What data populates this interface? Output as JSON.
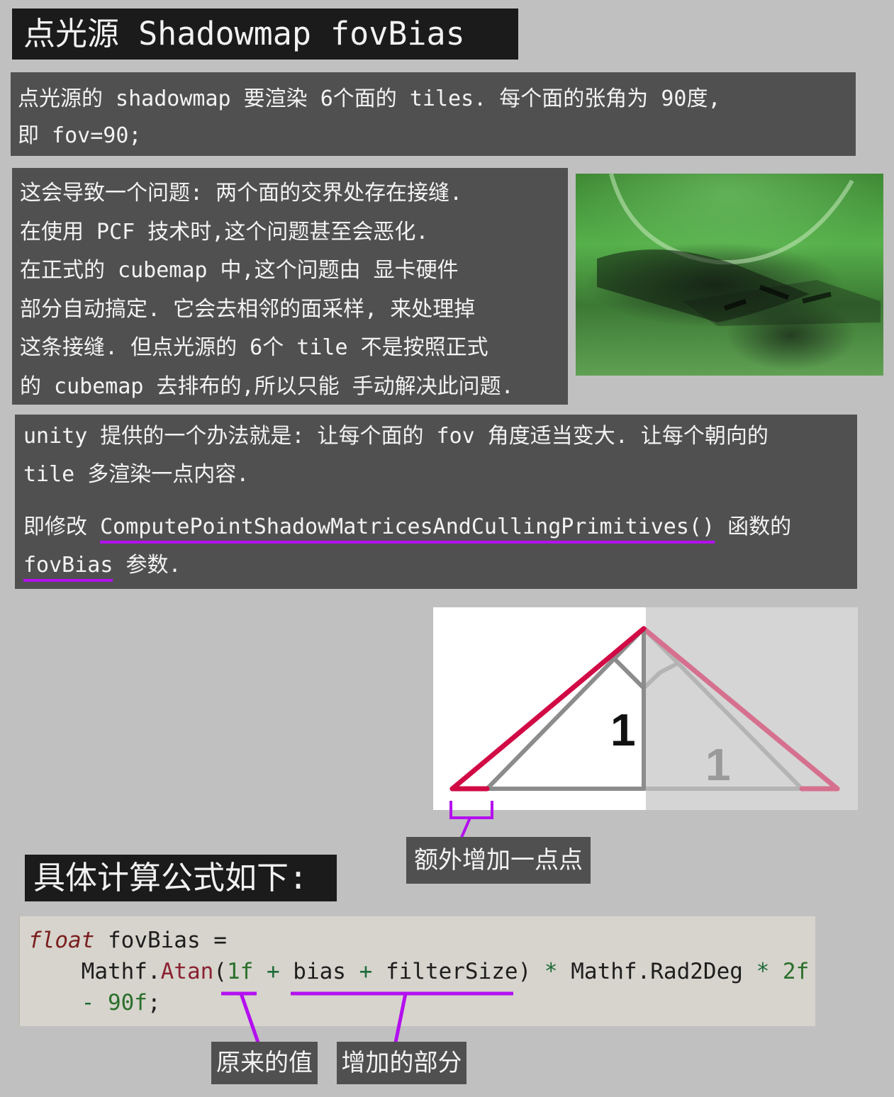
{
  "title": "点光源 Shadowmap fovBias",
  "intro": {
    "line1": "点光源的 shadowmap 要渲染 6个面的 tiles. 每个面的张角为 90度,",
    "line2": "即 fov=90;"
  },
  "problem": {
    "lines": [
      "这会导致一个问题: 两个面的交界处存在接缝.",
      "在使用 PCF 技术时,这个问题甚至会恶化.",
      "在正式的 cubemap 中,这个问题由 显卡硬件",
      "部分自动搞定. 它会去相邻的面采样, 来处理掉",
      "这条接缝. 但点光源的 6个 tile 不是按照正式",
      "的 cubemap 去排布的,所以只能 手动解决此问题."
    ]
  },
  "solution": {
    "line1": "unity 提供的一个办法就是: 让每个面的 fov 角度适当变大. 让每个朝向的",
    "line2": "tile 多渲染一点内容.",
    "line3_prefix": "即修改 ",
    "func_name": "ComputePointShadowMatricesAndCullingPrimitives()",
    "line3_suffix": " 函数的",
    "param_name": "fovBias",
    "line4_suffix": " 参数."
  },
  "diagram": {
    "label_main": "1",
    "label_faded": "1",
    "colors": {
      "edge": "#d10a45",
      "edge_faded": "#d6708f",
      "gray": "#8c8c8c",
      "gray_faded": "#b4b4b4",
      "accent": "#b40ff0"
    },
    "callout": "额外增加一点点"
  },
  "formula_heading": "具体计算公式如下:",
  "code": {
    "kw": "float",
    "var": " fovBias =",
    "l2_indent": "    ",
    "l2_obj": "Mathf.",
    "l2_fn": "Atan",
    "l2_open": "(",
    "l2_num1": "1f",
    "l2_plus1": " + ",
    "l2_bias": "bias",
    "l2_plus2": " + ",
    "l2_filter": "filterSize)",
    "l2_mul1": " * ",
    "l2_rad": "Mathf.Rad2Deg",
    "l2_mul2": " * ",
    "l2_num2": "2f",
    "l3_indent": "    ",
    "l3_minus": "- ",
    "l3_num": "90f",
    "l3_end": ";"
  },
  "labels": {
    "original": "原来的值",
    "added": "增加的部分"
  }
}
